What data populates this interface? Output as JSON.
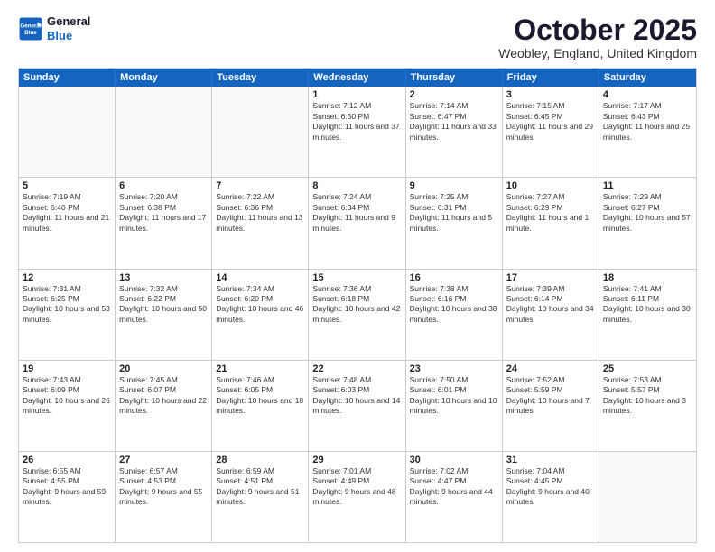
{
  "header": {
    "logo_line1": "General",
    "logo_line2": "Blue",
    "month": "October 2025",
    "location": "Weobley, England, United Kingdom"
  },
  "days_of_week": [
    "Sunday",
    "Monday",
    "Tuesday",
    "Wednesday",
    "Thursday",
    "Friday",
    "Saturday"
  ],
  "rows": [
    [
      {
        "day": "",
        "empty": true
      },
      {
        "day": "",
        "empty": true
      },
      {
        "day": "",
        "empty": true
      },
      {
        "day": "1",
        "sunrise": "Sunrise: 7:12 AM",
        "sunset": "Sunset: 6:50 PM",
        "daylight": "Daylight: 11 hours and 37 minutes."
      },
      {
        "day": "2",
        "sunrise": "Sunrise: 7:14 AM",
        "sunset": "Sunset: 6:47 PM",
        "daylight": "Daylight: 11 hours and 33 minutes."
      },
      {
        "day": "3",
        "sunrise": "Sunrise: 7:15 AM",
        "sunset": "Sunset: 6:45 PM",
        "daylight": "Daylight: 11 hours and 29 minutes."
      },
      {
        "day": "4",
        "sunrise": "Sunrise: 7:17 AM",
        "sunset": "Sunset: 6:43 PM",
        "daylight": "Daylight: 11 hours and 25 minutes."
      }
    ],
    [
      {
        "day": "5",
        "sunrise": "Sunrise: 7:19 AM",
        "sunset": "Sunset: 6:40 PM",
        "daylight": "Daylight: 11 hours and 21 minutes."
      },
      {
        "day": "6",
        "sunrise": "Sunrise: 7:20 AM",
        "sunset": "Sunset: 6:38 PM",
        "daylight": "Daylight: 11 hours and 17 minutes."
      },
      {
        "day": "7",
        "sunrise": "Sunrise: 7:22 AM",
        "sunset": "Sunset: 6:36 PM",
        "daylight": "Daylight: 11 hours and 13 minutes."
      },
      {
        "day": "8",
        "sunrise": "Sunrise: 7:24 AM",
        "sunset": "Sunset: 6:34 PM",
        "daylight": "Daylight: 11 hours and 9 minutes."
      },
      {
        "day": "9",
        "sunrise": "Sunrise: 7:25 AM",
        "sunset": "Sunset: 6:31 PM",
        "daylight": "Daylight: 11 hours and 5 minutes."
      },
      {
        "day": "10",
        "sunrise": "Sunrise: 7:27 AM",
        "sunset": "Sunset: 6:29 PM",
        "daylight": "Daylight: 11 hours and 1 minute."
      },
      {
        "day": "11",
        "sunrise": "Sunrise: 7:29 AM",
        "sunset": "Sunset: 6:27 PM",
        "daylight": "Daylight: 10 hours and 57 minutes."
      }
    ],
    [
      {
        "day": "12",
        "sunrise": "Sunrise: 7:31 AM",
        "sunset": "Sunset: 6:25 PM",
        "daylight": "Daylight: 10 hours and 53 minutes."
      },
      {
        "day": "13",
        "sunrise": "Sunrise: 7:32 AM",
        "sunset": "Sunset: 6:22 PM",
        "daylight": "Daylight: 10 hours and 50 minutes."
      },
      {
        "day": "14",
        "sunrise": "Sunrise: 7:34 AM",
        "sunset": "Sunset: 6:20 PM",
        "daylight": "Daylight: 10 hours and 46 minutes."
      },
      {
        "day": "15",
        "sunrise": "Sunrise: 7:36 AM",
        "sunset": "Sunset: 6:18 PM",
        "daylight": "Daylight: 10 hours and 42 minutes."
      },
      {
        "day": "16",
        "sunrise": "Sunrise: 7:38 AM",
        "sunset": "Sunset: 6:16 PM",
        "daylight": "Daylight: 10 hours and 38 minutes."
      },
      {
        "day": "17",
        "sunrise": "Sunrise: 7:39 AM",
        "sunset": "Sunset: 6:14 PM",
        "daylight": "Daylight: 10 hours and 34 minutes."
      },
      {
        "day": "18",
        "sunrise": "Sunrise: 7:41 AM",
        "sunset": "Sunset: 6:11 PM",
        "daylight": "Daylight: 10 hours and 30 minutes."
      }
    ],
    [
      {
        "day": "19",
        "sunrise": "Sunrise: 7:43 AM",
        "sunset": "Sunset: 6:09 PM",
        "daylight": "Daylight: 10 hours and 26 minutes."
      },
      {
        "day": "20",
        "sunrise": "Sunrise: 7:45 AM",
        "sunset": "Sunset: 6:07 PM",
        "daylight": "Daylight: 10 hours and 22 minutes."
      },
      {
        "day": "21",
        "sunrise": "Sunrise: 7:46 AM",
        "sunset": "Sunset: 6:05 PM",
        "daylight": "Daylight: 10 hours and 18 minutes."
      },
      {
        "day": "22",
        "sunrise": "Sunrise: 7:48 AM",
        "sunset": "Sunset: 6:03 PM",
        "daylight": "Daylight: 10 hours and 14 minutes."
      },
      {
        "day": "23",
        "sunrise": "Sunrise: 7:50 AM",
        "sunset": "Sunset: 6:01 PM",
        "daylight": "Daylight: 10 hours and 10 minutes."
      },
      {
        "day": "24",
        "sunrise": "Sunrise: 7:52 AM",
        "sunset": "Sunset: 5:59 PM",
        "daylight": "Daylight: 10 hours and 7 minutes."
      },
      {
        "day": "25",
        "sunrise": "Sunrise: 7:53 AM",
        "sunset": "Sunset: 5:57 PM",
        "daylight": "Daylight: 10 hours and 3 minutes."
      }
    ],
    [
      {
        "day": "26",
        "sunrise": "Sunrise: 6:55 AM",
        "sunset": "Sunset: 4:55 PM",
        "daylight": "Daylight: 9 hours and 59 minutes."
      },
      {
        "day": "27",
        "sunrise": "Sunrise: 6:57 AM",
        "sunset": "Sunset: 4:53 PM",
        "daylight": "Daylight: 9 hours and 55 minutes."
      },
      {
        "day": "28",
        "sunrise": "Sunrise: 6:59 AM",
        "sunset": "Sunset: 4:51 PM",
        "daylight": "Daylight: 9 hours and 51 minutes."
      },
      {
        "day": "29",
        "sunrise": "Sunrise: 7:01 AM",
        "sunset": "Sunset: 4:49 PM",
        "daylight": "Daylight: 9 hours and 48 minutes."
      },
      {
        "day": "30",
        "sunrise": "Sunrise: 7:02 AM",
        "sunset": "Sunset: 4:47 PM",
        "daylight": "Daylight: 9 hours and 44 minutes."
      },
      {
        "day": "31",
        "sunrise": "Sunrise: 7:04 AM",
        "sunset": "Sunset: 4:45 PM",
        "daylight": "Daylight: 9 hours and 40 minutes."
      },
      {
        "day": "",
        "empty": true
      }
    ]
  ]
}
